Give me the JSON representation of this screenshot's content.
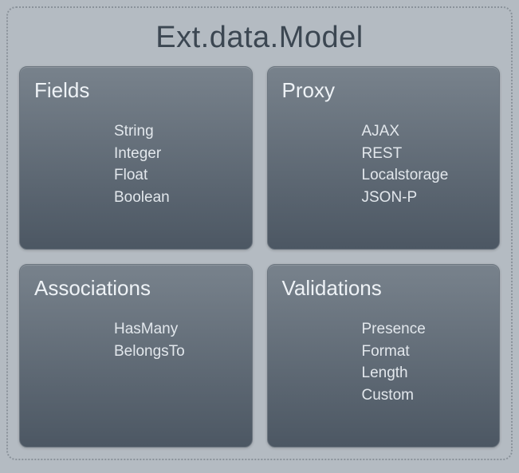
{
  "title": "Ext.data.Model",
  "cards": [
    {
      "title": "Fields",
      "items": [
        "String",
        "Integer",
        "Float",
        "Boolean"
      ]
    },
    {
      "title": "Proxy",
      "items": [
        "AJAX",
        "REST",
        "Localstorage",
        "JSON-P"
      ]
    },
    {
      "title": "Associations",
      "items": [
        "HasMany",
        "BelongsTo"
      ]
    },
    {
      "title": "Validations",
      "items": [
        "Presence",
        "Format",
        "Length",
        "Custom"
      ]
    }
  ]
}
